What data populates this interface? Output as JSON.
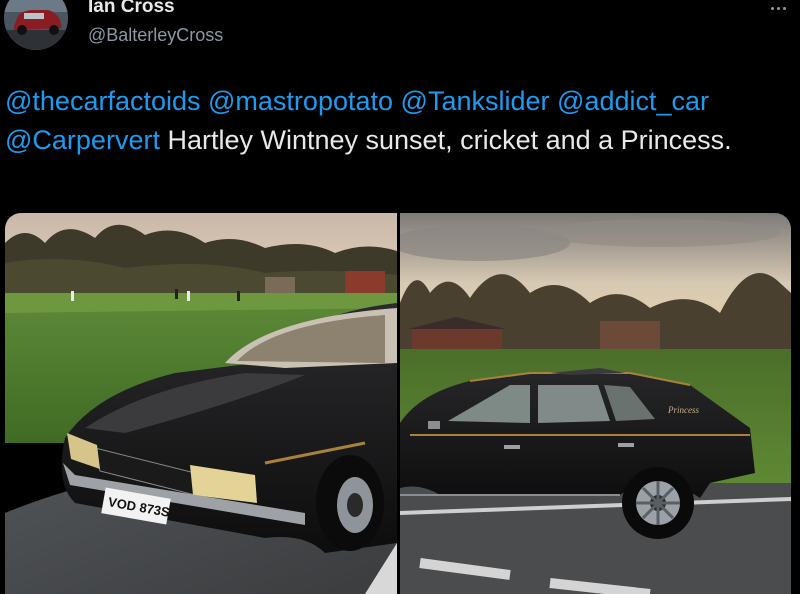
{
  "tweet": {
    "author": {
      "name": "Ian Cross",
      "handle": "@BalterleyCross",
      "avatar_icon": "avatar-car-photo-icon"
    },
    "more_icon": "more-dots-icon",
    "text": {
      "mentions": [
        "@thecarfactoids",
        "@mastropotato",
        "@Tankslider",
        "@addict_car",
        "@Carpervert"
      ],
      "body": "Hartley Wintney sunset, cricket and a Princess."
    },
    "media": [
      {
        "description_icon": "car-front-three-quarter-photo",
        "plate": "VOD 873S"
      },
      {
        "description_icon": "car-side-profile-photo",
        "badge": "Princess"
      }
    ]
  },
  "colors": {
    "background": "#000000",
    "text": "#e7e9ea",
    "secondary_text": "#8b98a5",
    "link": "#1d9bf0"
  }
}
